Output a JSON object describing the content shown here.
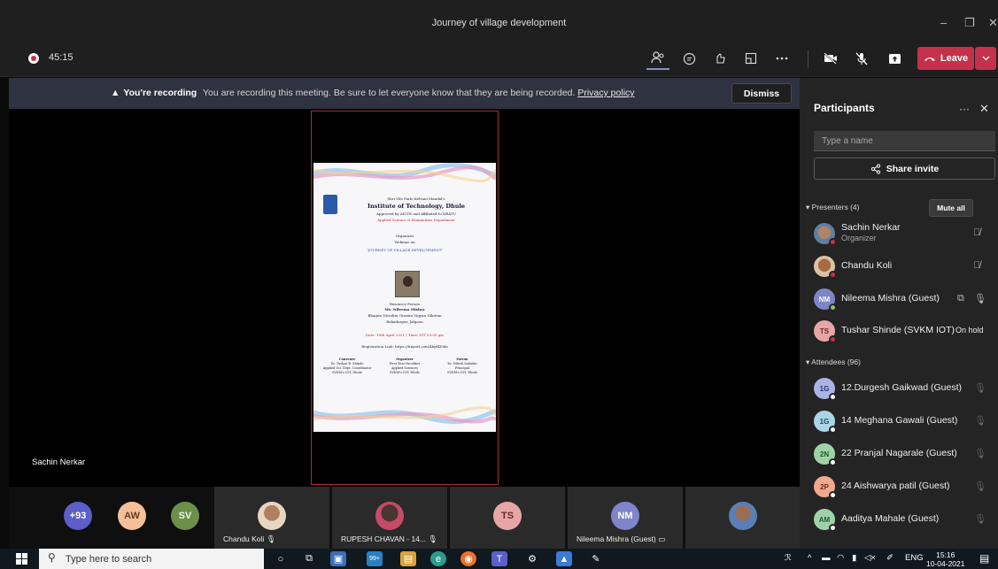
{
  "window": {
    "title": "Journey of village development",
    "controls": [
      "–",
      "❐",
      "✕"
    ]
  },
  "controlbar": {
    "timer": "45:15",
    "leave_label": "Leave"
  },
  "banner": {
    "headline": "You're recording",
    "message": "You are recording this meeting. Be sure to let everyone know that they are being recorded.",
    "link": "Privacy policy",
    "dismiss_label": "Dismiss"
  },
  "flyer": {
    "org": "Shri Vile Parle Kelvani Mandal's",
    "institute": "Institute of Technology, Dhule",
    "approval": "Approved by AICTE and Affiliated to DBATU",
    "department": "Applied Science & Humanities Department",
    "organizes": "Organizes",
    "webinar_on": "Webinar on",
    "topic": "\"JOURNEY OF VILLAGE DEVELOPMENT\"",
    "resource_person": "Resource Person",
    "speaker": "Ms. Nileema Mishra",
    "speaker_org": "Bhagini Nivedita Gramin Vigyan Niketan",
    "speaker_place": "Bahadarpur, Jalgaon",
    "date": "Date: 10th April 2021 | Time: IST 03:00 pm",
    "registration": "Registration Link: https://tinyurl.com/4bpf4f3de",
    "columns": [
      {
        "role": "Convener",
        "lines": [
          "Dr. Tushar B. Shinde",
          "Applied Sci. Dept. Coordinator",
          "SVKM's IOT, Dhule"
        ]
      },
      {
        "role": "Organizer",
        "lines": [
          "First Year Faculties",
          "Applied Sciences",
          "SVKM's IOT, Dhule"
        ]
      },
      {
        "role": "Patron",
        "lines": [
          "Dr. Nilesh Salunke",
          "Principal",
          "SVKM's IOT, Dhule"
        ]
      }
    ]
  },
  "stage": {
    "presenter_name": "Sachin Nerkar"
  },
  "gallery": {
    "overflow": "+93",
    "avatars": [
      {
        "initials": "AW",
        "bg": "#f4c09a",
        "fg": "#6b3a1a"
      },
      {
        "initials": "SV",
        "bg": "#6c8f4a",
        "fg": "#f1f7e8"
      }
    ],
    "tiles": [
      {
        "label": "Chandu Koli",
        "icon": "🎙"
      },
      {
        "label": "RUPESH CHAVAN - 14...",
        "icon": "🎙"
      },
      {
        "label": "",
        "initials": "TS"
      },
      {
        "label": "Nileema Mishra (Guest)",
        "initials": "NM"
      },
      {
        "label": ""
      }
    ]
  },
  "panel": {
    "title": "Participants",
    "search_placeholder": "Type a name",
    "share_label": "Share invite",
    "presenters_label": "Presenters (4)",
    "mute_all": "Mute all",
    "attendees_label": "Attendees (96)",
    "presenters": [
      {
        "name": "Sachin Nerkar",
        "sub": "Organizer",
        "type": "photo",
        "status": "#c4314b"
      },
      {
        "name": "Chandu Koli",
        "sub": "",
        "type": "photo",
        "status": "#c4314b"
      },
      {
        "name": "Nileema Mishra (Guest)",
        "sub": "",
        "initials": "NM",
        "bg": "#7e86c9",
        "status": "#92c353"
      },
      {
        "name": "Tushar Shinde (SVKM IOT)",
        "sub": "",
        "initials": "TS",
        "bg": "#e7a6a6",
        "status": "#c4314b",
        "onhold": "On hold"
      }
    ],
    "attendees": [
      {
        "name": "12.Durgesh Gaikwad (Guest)",
        "initials": "1G",
        "bg": "#a9b4e6"
      },
      {
        "name": "14 Meghana Gawali (Guest)",
        "initials": "1G",
        "bg": "#a9d6e6"
      },
      {
        "name": "22 Pranjal Nagarale (Guest)",
        "initials": "2N",
        "bg": "#9fd3a7"
      },
      {
        "name": "24 Aishwarya patil (Guest)",
        "initials": "2P",
        "bg": "#f0a98c"
      },
      {
        "name": "Aaditya Mahale (Guest)",
        "initials": "AM",
        "bg": "#9fd3a7"
      }
    ]
  },
  "taskbar": {
    "search_placeholder": "Type here to search",
    "lang": "ENG",
    "time": "15:16",
    "date": "10-04-2021",
    "badge": "99+"
  }
}
